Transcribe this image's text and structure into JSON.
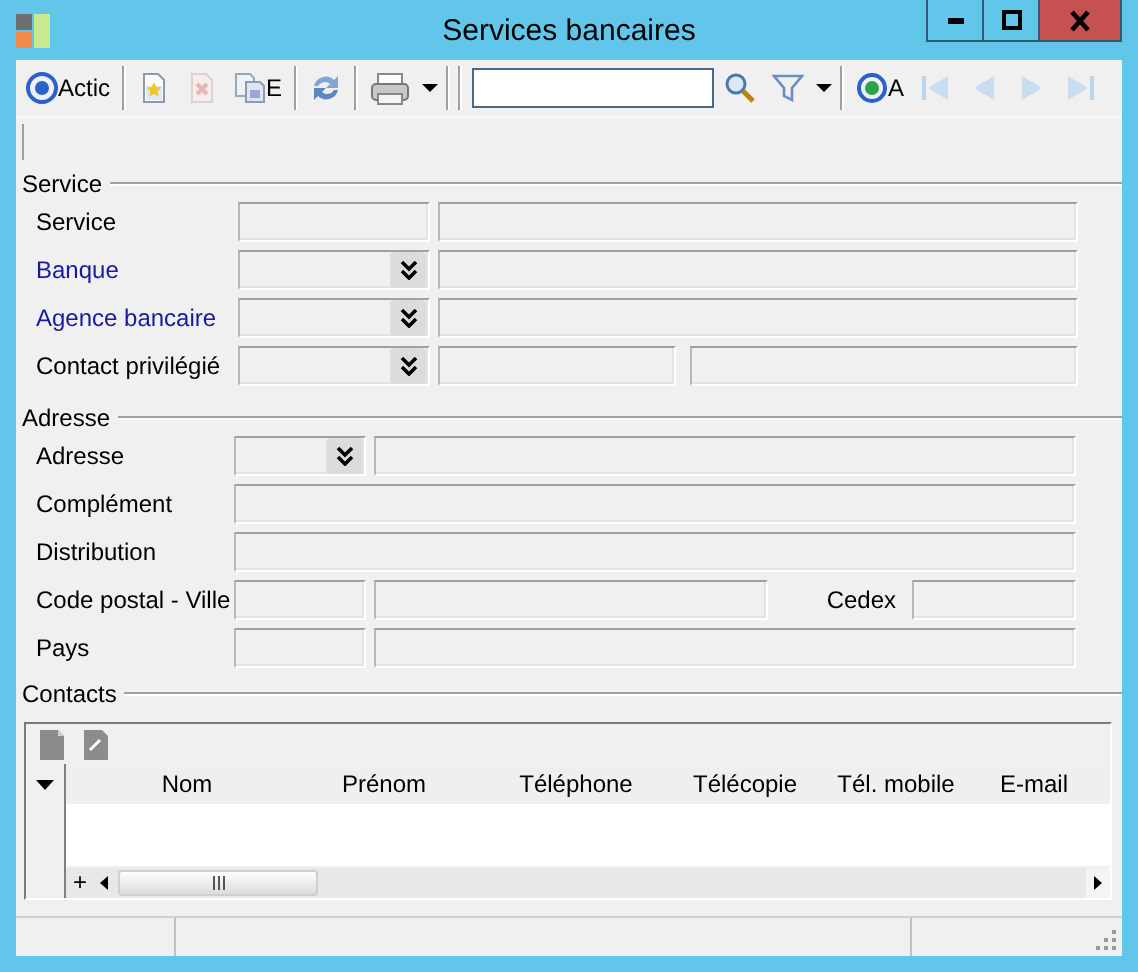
{
  "window": {
    "title": "Services bancaires"
  },
  "toolbar": [
    {
      "kind": "action",
      "label": "Actic",
      "disabled": false
    },
    {
      "kind": "separator"
    },
    {
      "kind": "new",
      "disabled": false
    },
    {
      "kind": "delete",
      "disabled": true
    },
    {
      "kind": "copy",
      "label": "E",
      "disabled": false
    },
    {
      "kind": "separator"
    },
    {
      "kind": "refresh",
      "disabled": false
    },
    {
      "kind": "separator"
    },
    {
      "kind": "print",
      "disabled": false
    },
    {
      "kind": "menu",
      "disabled": false
    },
    {
      "kind": "separator"
    },
    {
      "kind": "separator"
    },
    {
      "kind": "search"
    },
    {
      "kind": "find",
      "disabled": false
    },
    {
      "kind": "filter",
      "disabled": false
    },
    {
      "kind": "menu",
      "disabled": false
    },
    {
      "kind": "separator"
    },
    {
      "kind": "reload",
      "label": "A",
      "disabled": false
    },
    {
      "kind": "first",
      "disabled": true
    },
    {
      "kind": "prev",
      "disabled": true
    },
    {
      "kind": "next",
      "disabled": true
    },
    {
      "kind": "last",
      "disabled": true
    }
  ],
  "sections": [
    {
      "title": "Service",
      "rows": [
        {
          "label": "Service",
          "link": false,
          "fields": [
            {
              "kind": "code"
            },
            {
              "kind": "text"
            }
          ]
        },
        {
          "label": "Banque",
          "link": true,
          "fields": [
            {
              "kind": "combo"
            },
            {
              "kind": "text"
            }
          ]
        },
        {
          "label": "Agence bancaire",
          "link": true,
          "fields": [
            {
              "kind": "combo"
            },
            {
              "kind": "text"
            }
          ]
        },
        {
          "label": "Contact privilégié",
          "link": false,
          "fields": [
            {
              "kind": "combo"
            },
            {
              "kind": "text"
            },
            {
              "kind": "text"
            }
          ]
        }
      ]
    },
    {
      "title": "Adresse",
      "rows": [
        {
          "label": "Adresse",
          "link": false,
          "fields": [
            {
              "kind": "combo"
            },
            {
              "kind": "text"
            }
          ]
        },
        {
          "label": "Complément",
          "link": false,
          "fields": [
            {
              "kind": "text"
            }
          ]
        },
        {
          "label": "Distribution",
          "link": false,
          "fields": [
            {
              "kind": "text"
            }
          ]
        },
        {
          "label": "Code postal - Ville",
          "link": false,
          "fields": [
            {
              "kind": "code"
            },
            {
              "kind": "text"
            },
            {
              "kind": "label",
              "text": "Cedex"
            },
            {
              "kind": "text"
            }
          ]
        },
        {
          "label": "Pays",
          "link": false,
          "fields": [
            {
              "kind": "code"
            },
            {
              "kind": "text"
            }
          ]
        }
      ]
    }
  ],
  "contacts": {
    "title": "Contacts",
    "columns": [
      "Nom",
      "Prénom",
      "Téléphone",
      "Télécopie",
      "Tél. mobile",
      "E-mail"
    ],
    "add_row": "+"
  }
}
